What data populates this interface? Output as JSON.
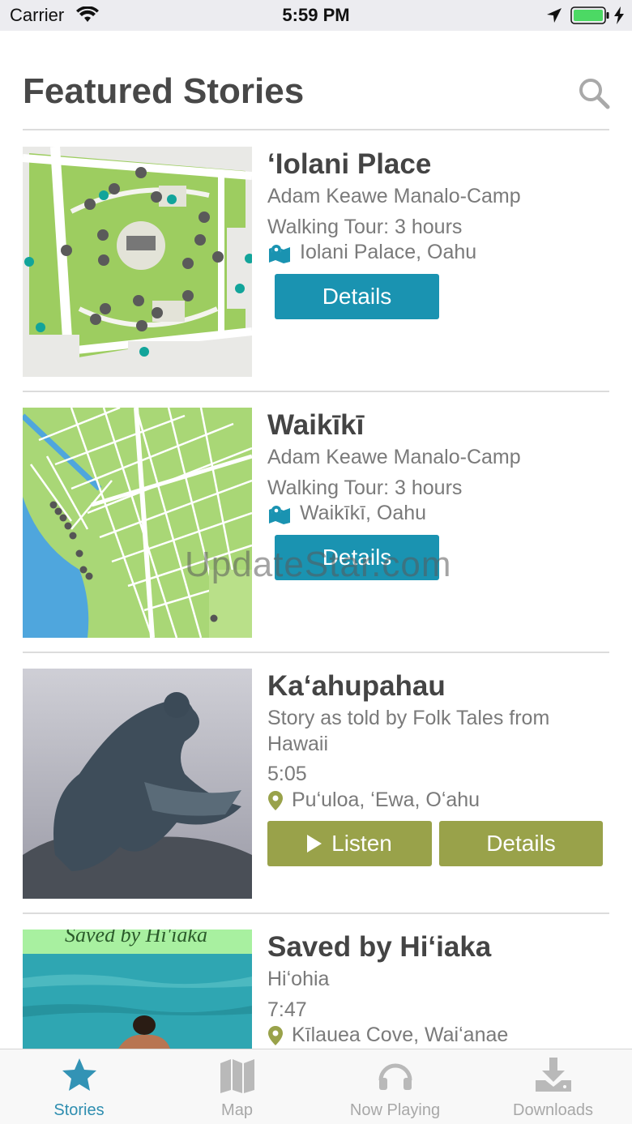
{
  "status_bar": {
    "carrier": "Carrier",
    "time": "5:59 PM"
  },
  "header": {
    "title": "Featured Stories"
  },
  "stories": [
    {
      "title": "ʻIolani Place",
      "line1": "Adam Keawe Manalo-Camp",
      "line2": "Walking Tour: 3 hours",
      "location": "Iolani Palace, Oahu",
      "details_label": "Details"
    },
    {
      "title": "Waikīkī",
      "line1": "Adam Keawe Manalo-Camp",
      "line2": "Walking Tour: 3 hours",
      "location": "Waikīkī, Oahu",
      "details_label": "Details"
    },
    {
      "title": "Kaʻahupahau",
      "line1": "Story as told by Folk Tales from",
      "line1b": "Hawaii",
      "line2": "5:05",
      "location": "Puʻuloa, ʻEwa, Oʻahu",
      "listen_label": "Listen",
      "details_label": "Details"
    },
    {
      "title": "Saved by Hiʻiaka",
      "line1": "Hiʻohia",
      "line2": "7:47",
      "location": "Kīlauea Cove, Waiʻanae",
      "image_caption": "Saved by Hi'iaka"
    }
  ],
  "watermark": "UpdateStar.com",
  "tabs": [
    {
      "label": "Stories",
      "icon": "star-icon",
      "active": true
    },
    {
      "label": "Map",
      "icon": "map-icon",
      "active": false
    },
    {
      "label": "Now Playing",
      "icon": "headphones-icon",
      "active": false
    },
    {
      "label": "Downloads",
      "icon": "download-icon",
      "active": false
    }
  ],
  "colors": {
    "teal": "#1a93b1",
    "olive": "#99a24a",
    "tab_active": "#2f8eb0"
  }
}
